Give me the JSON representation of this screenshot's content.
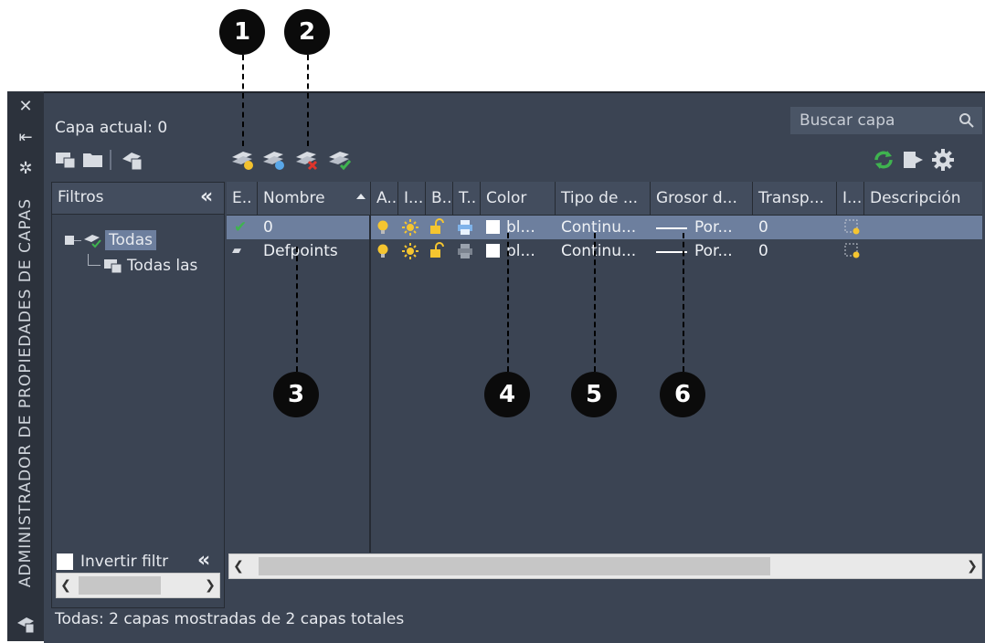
{
  "callouts": [
    "1",
    "2",
    "3",
    "4",
    "5",
    "6"
  ],
  "sidebar": {
    "title": "ADMINISTRADOR DE PROPIEDADES DE CAPAS",
    "icons": [
      "close-icon",
      "autohide-icon",
      "properties-icon",
      "layer-manager-icon"
    ]
  },
  "header": {
    "current_layer": "Capa actual: 0",
    "search_placeholder": "Buscar capa"
  },
  "toolbar": {
    "left_icons": [
      "new-property-filter-icon",
      "new-group-filter-icon",
      "layer-states-manager-icon"
    ],
    "layer_icons": [
      "new-layer-icon",
      "new-layer-vp-frozen-icon",
      "delete-layer-icon",
      "set-current-icon"
    ],
    "right_icons": [
      "refresh-icon",
      "settings-icon",
      "gear-icon"
    ]
  },
  "filters": {
    "header": "Filtros",
    "collapse": "«",
    "tree": [
      {
        "label": "Todas",
        "selected": true
      },
      {
        "label": "Todas las capas usadas"
      }
    ],
    "invert_label": "Invertir filtr",
    "invert_collapse": "«"
  },
  "columns": [
    "E..",
    "Nombre",
    "A..",
    "I...",
    "B..",
    "T..",
    "Color",
    "Tipo de ...",
    "Grosor d...",
    "Transp...",
    "I...",
    "Descripción"
  ],
  "rows": [
    {
      "status": "✔",
      "name": "0",
      "color": "bl...",
      "linetype": "Continu...",
      "lineweight": "Por...",
      "transparency": "0",
      "selected": true
    },
    {
      "status": "▰",
      "name": "Defpoints",
      "color": "bl...",
      "linetype": "Continu...",
      "lineweight": "Por...",
      "transparency": "0",
      "selected": false
    }
  ],
  "footer": "Todas: 2 capas mostradas de 2 capas totales",
  "colors": {
    "panel": "#3b4453",
    "selected_row": "#6d7f9e",
    "accent_green": "#3fb34f"
  }
}
